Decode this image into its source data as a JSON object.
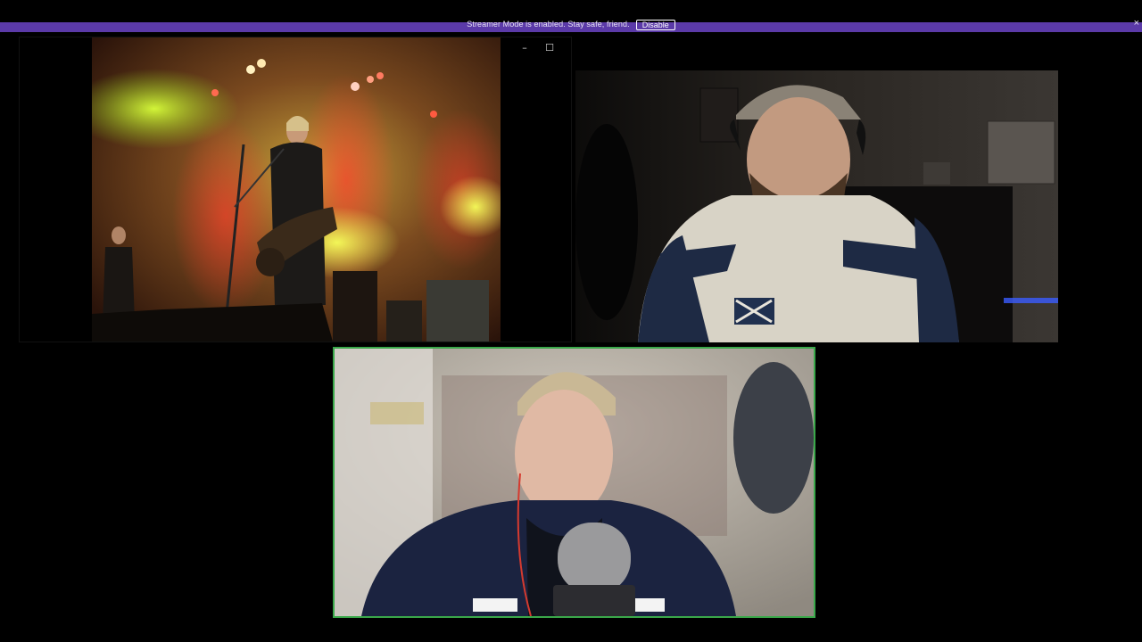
{
  "banner": {
    "text": "Streamer Mode is enabled. Stay safe, friend.",
    "button_label": "Disable",
    "close_glyph": "×",
    "color": "#5b3aa8"
  },
  "concert_window": {
    "controls": {
      "minimize_glyph": "–",
      "maximize_glyph": "☐",
      "close_glyph": "✕"
    }
  },
  "participants": [
    {
      "id": "cam-top-right",
      "active_speaker": false
    },
    {
      "id": "cam-bottom-center",
      "active_speaker": true,
      "border_color": "#3aa84a"
    }
  ],
  "scotland_patch_text": "SCOTLAND"
}
